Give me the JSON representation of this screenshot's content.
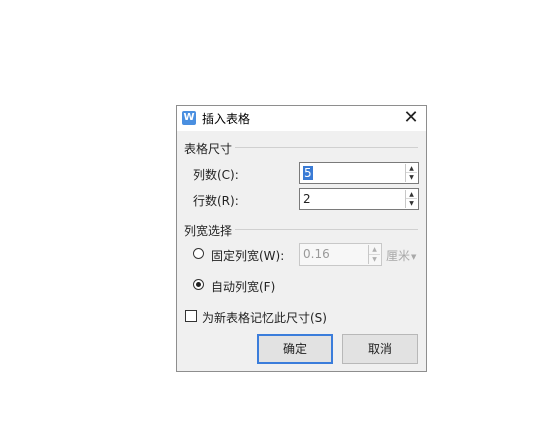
{
  "dialog": {
    "title": "插入表格",
    "app_icon_glyph": "W",
    "close_glyph": "✕",
    "table_size": {
      "label": "表格尺寸",
      "columns_label": "列数(C):",
      "columns_value": "5",
      "rows_label": "行数(R):",
      "rows_value": "2"
    },
    "column_width": {
      "label": "列宽选择",
      "fixed_label": "固定列宽(W):",
      "fixed_value": "0.16",
      "unit": "厘米",
      "auto_label": "自动列宽(F)",
      "selected": "auto"
    },
    "remember_label": "为新表格记忆此尺寸(S)",
    "remember_checked": false,
    "ok_label": "确定",
    "cancel_label": "取消"
  },
  "colors": {
    "accent": "#3b7ddb",
    "selection": "#3a7bd5",
    "dialog_bg": "#f0f0f0"
  }
}
